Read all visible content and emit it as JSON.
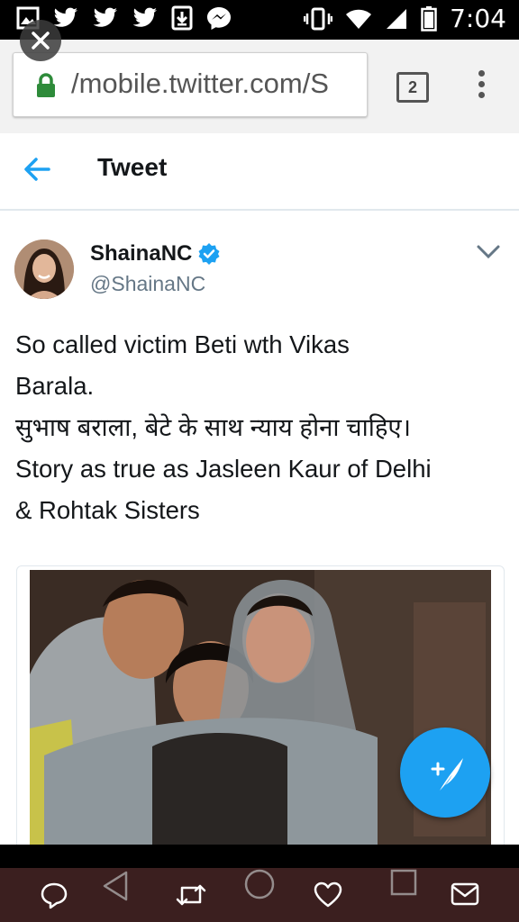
{
  "status_bar": {
    "time": "7:04",
    "left_icons": [
      "image-icon",
      "twitter-icon",
      "twitter-icon",
      "twitter-icon",
      "download-icon",
      "messenger-icon"
    ],
    "right_icons": [
      "vibrate-icon",
      "wifi-icon",
      "signal-icon",
      "battery-icon"
    ]
  },
  "browser": {
    "url": "/mobile.twitter.com/S",
    "tab_count": "2"
  },
  "header": {
    "title": "Tweet"
  },
  "tweet": {
    "display_name": "ShainaNC",
    "handle": "@ShainaNC",
    "verified": true,
    "text_lines": [
      "So called victim Beti wth Vikas",
      "Barala.",
      "सुभाष बराला, बेटे के साथ न्याय होना चाहिए।",
      "Story as true as Jasleen Kaur of Delhi",
      "& Rohtak Sisters"
    ]
  },
  "colors": {
    "twitter_blue": "#1da1f2",
    "nav_bar": "#3b1f1f",
    "lock_green": "#2e8b3a"
  }
}
